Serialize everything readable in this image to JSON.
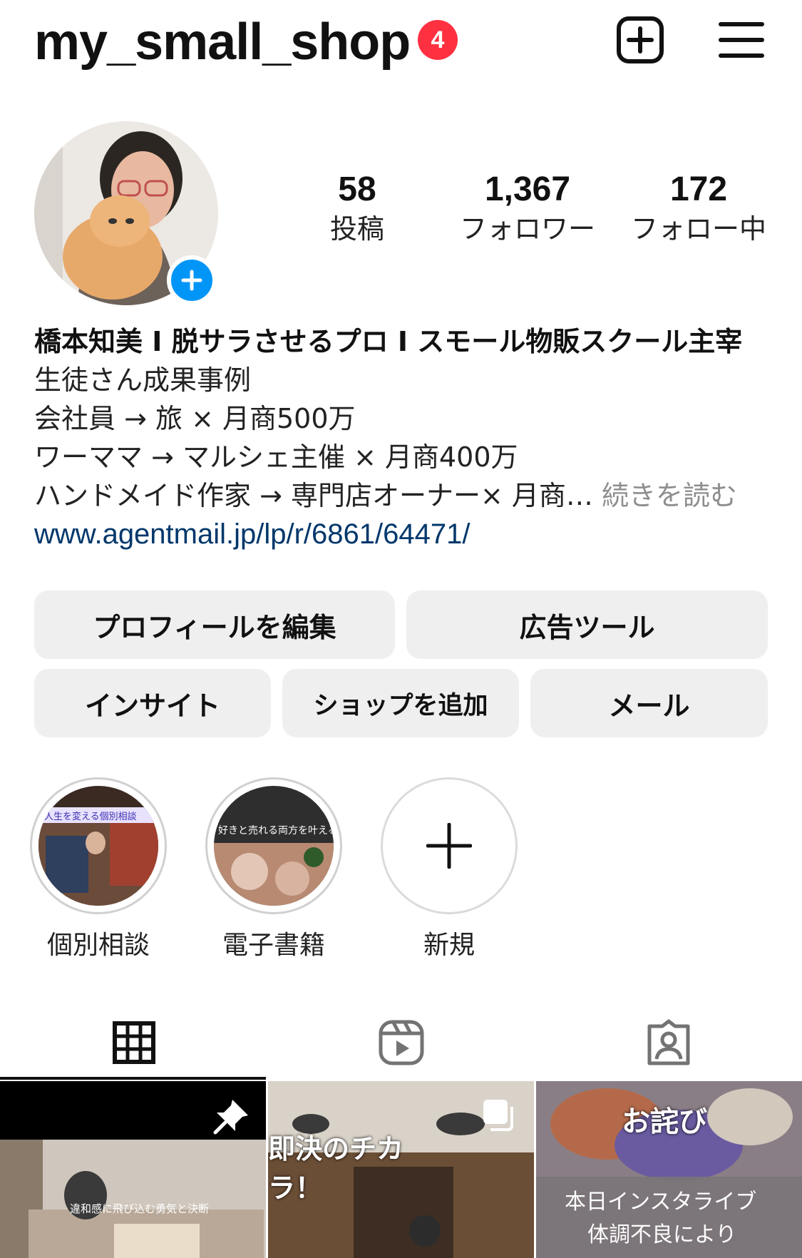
{
  "header": {
    "username": "my_small_shop",
    "notification_count": "4"
  },
  "profile": {
    "stats": [
      {
        "value": "58",
        "label": "投稿"
      },
      {
        "value": "1,367",
        "label": "フォロワー"
      },
      {
        "value": "172",
        "label": "フォロー中"
      }
    ],
    "bio": {
      "name": "橋本知美 I 脱サラさせるプロ I スモール物販スクール主宰",
      "lines": [
        "生徒さん成果事例",
        "会社員 → 旅 × 月商500万",
        "ワーママ → マルシェ主催 × 月商400万",
        "ハンドメイド作家 → 専門店オーナー× 月商…"
      ],
      "more": "続きを読む",
      "link": "www.agentmail.jp/lp/r/6861/64471/"
    }
  },
  "buttons": {
    "edit_profile": "プロフィールを編集",
    "ad_tools": "広告ツール",
    "insights": "インサイト",
    "add_shop": "ショップを追加",
    "mail": "メール"
  },
  "highlights": [
    {
      "label": "個別相談",
      "cover_text": "人生を変える個別相談"
    },
    {
      "label": "電子書籍",
      "cover_text": "好きと売れる両方を叶える"
    },
    {
      "label": "新規"
    }
  ],
  "posts": [
    {
      "caption": "違和感に飛び込む勇気と決断",
      "pinned": true
    },
    {
      "caption": "即決のチカラ！",
      "multi": true
    },
    {
      "title": "お詫び",
      "caption_lines": [
        "本日インスタライブ",
        "体調不良により"
      ]
    }
  ]
}
